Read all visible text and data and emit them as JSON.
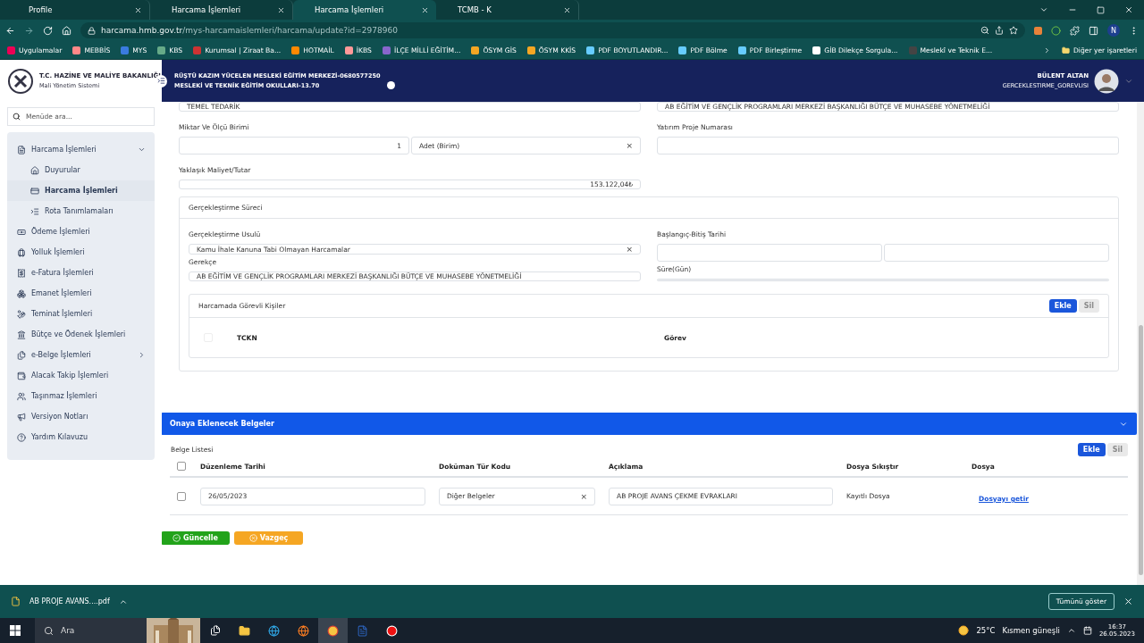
{
  "browser": {
    "tabs": [
      {
        "title": "Profile",
        "selected": false
      },
      {
        "title": "Harcama İşlemleri",
        "selected": false
      },
      {
        "title": "Harcama İşlemleri",
        "selected": true
      },
      {
        "title": "TCMB - K",
        "selected": false
      }
    ],
    "url_host": "harcama.hmb.gov.tr",
    "url_path": "/mys-harcamaislemleri/harcama/update?id=2978960",
    "profile_initial": "N",
    "bookmarks": [
      "Uygulamalar",
      "MEBBİS",
      "MYS",
      "KBS",
      "Kurumsal | Ziraat Ba...",
      "HOTMAİL",
      "İKBS",
      "İLÇE MİLLİ EĞİTİM...",
      "ÖSYM GİS",
      "ÖSYM KKİS",
      "PDF BOYUTLANDIR...",
      "PDF Bölme",
      "PDF Birleştirme",
      "GİB Dilekçe Sorgula...",
      "Meslekî ve Teknik E..."
    ],
    "more_bookmarks": "Diğer yer işaretleri"
  },
  "app": {
    "org_title": "T.C. HAZİNE VE MALİYE BAKANLIĞI",
    "org_subtitle": "Mali Yönetim Sistemi",
    "unit_line1": "RÜŞTÜ KAZIM YÜCELEN MESLEKİ EĞİTİM MERKEZİ-0680577250",
    "unit_line2": "MESLEKİ VE TEKNİK EĞİTİM OKULLARI-13.70",
    "user_name": "BÜLENT ALTAN",
    "user_role": "GERCEKLESTIRME_GOREVLISI"
  },
  "sidebar": {
    "search_placeholder": "Menüde ara...",
    "items": [
      {
        "label": "Harcama İşlemleri",
        "expanded": true,
        "children": [
          {
            "label": "Duyurular",
            "selected": false
          },
          {
            "label": "Harcama İşlemleri",
            "selected": true
          },
          {
            "label": "Rota Tanımlamaları",
            "selected": false
          }
        ]
      },
      {
        "label": "Ödeme İşlemleri"
      },
      {
        "label": "Yolluk İşlemleri"
      },
      {
        "label": "e-Fatura İşlemleri"
      },
      {
        "label": "Emanet İşlemleri"
      },
      {
        "label": "Teminat İşlemleri"
      },
      {
        "label": "Bütçe ve Ödenek İşlemleri"
      },
      {
        "label": "e-Belge İşlemleri",
        "expanded": false
      },
      {
        "label": "Alacak Takip İşlemleri"
      },
      {
        "label": "Taşınmaz İşlemleri"
      },
      {
        "label": "Versiyon Notları"
      },
      {
        "label": "Yardım Kılavuzu"
      }
    ]
  },
  "form": {
    "top_left_value": "TEMEL TEDARİK",
    "top_right_value": "AB EĞİTİM VE GENÇLİK PROGRAMLARI MERKEZİ BAŞKANLIĞI BÜTÇE VE MUHASEBE YÖNETMELİĞİ",
    "quantity_label": "Miktar Ve Ölçü Birimi",
    "quantity": "1",
    "unit": "Adet (Birim)",
    "clear": "×",
    "project_label": "Yatırım Proje Numarası",
    "cost_label": "Yaklaşık Maliyet/Tutar",
    "cost": "153.122,04₺"
  },
  "process": {
    "title": "Gerçekleştirme Süreci",
    "method_label": "Gerçekleştirme Usulü",
    "method": "Kamu İhale Kanuna Tabi Olmayan Harcamalar",
    "clear": "×",
    "date_label": "Başlangıç-Bitiş Tarihi",
    "reason_label": "Gerekçe",
    "reason": "AB EĞİTİM VE GENÇLİK PROGRAMLARI MERKEZİ BAŞKANLIĞI BÜTÇE VE MUHASEBE YÖNETMELİĞİ",
    "duration_label": "Süre(Gün)",
    "persons": {
      "title": "Harcamada Görevli Kişiler",
      "add": "Ekle",
      "delete": "Sil",
      "delete_disabled": true,
      "columns": [
        "TCKN",
        "Görev"
      ],
      "all_checked": false
    }
  },
  "documents": {
    "title": "Onaya Eklenecek Belgeler",
    "expanded": true,
    "list_title": "Belge Listesi",
    "add": "Ekle",
    "delete": "Sil",
    "delete_disabled": true,
    "columns": [
      "Düzenleme Tarihi",
      "Doküman Tür Kodu",
      "Açıklama",
      "Dosya Sıkıştır",
      "Dosya"
    ],
    "all_checked": false,
    "rows": [
      {
        "checked": false,
        "date": "26/05/2023",
        "type": "Diğer Belgeler",
        "clear": "×",
        "description": "AB PROJE AVANS ÇEKME EVRAKLARI",
        "status": "Kayıtlı Dosya",
        "link": "Dosyayı getir"
      }
    ]
  },
  "actions": {
    "update": "Güncelle",
    "cancel": "Vazgeç"
  },
  "download_bar": {
    "file": "AB PROJE AVANS....pdf",
    "show_all": "Tümünü göster"
  },
  "taskbar": {
    "search": "Ara",
    "temperature": "25°C",
    "weather": "Kısmen güneşli",
    "time": "16:37",
    "date": "26.05.2023"
  }
}
